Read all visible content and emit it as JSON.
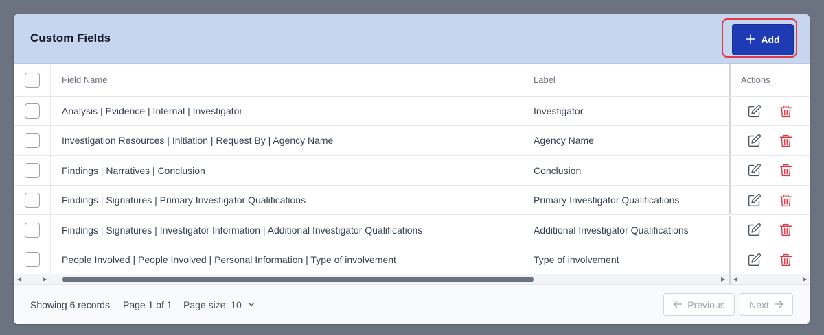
{
  "header": {
    "title": "Custom Fields",
    "add_label": "Add"
  },
  "columns": {
    "field_name": "Field Name",
    "label": "Label",
    "actions": "Actions"
  },
  "rows": [
    {
      "field_name": "Analysis | Evidence | Internal | Investigator",
      "label": "Investigator"
    },
    {
      "field_name": "Investigation Resources | Initiation | Request By | Agency Name",
      "label": "Agency Name"
    },
    {
      "field_name": "Findings | Narratives | Conclusion",
      "label": "Conclusion"
    },
    {
      "field_name": "Findings | Signatures | Primary Investigator Qualifications",
      "label": "Primary Investigator Qualifications"
    },
    {
      "field_name": "Findings | Signatures | Investigator Information | Additional Investigator Qualifications",
      "label": "Additional Investigator Qualifications"
    },
    {
      "field_name": "People Involved | People Involved | Personal Information | Type of involvement",
      "label": "Type of involvement"
    }
  ],
  "footer": {
    "records": "Showing 6 records",
    "page": "Page 1 of 1",
    "page_size": "Page size: 10",
    "previous": "Previous",
    "next": "Next"
  },
  "icons": {
    "add": "plus-icon",
    "edit": "pencil-square-icon",
    "delete": "trash-icon",
    "page_size_toggle": "chevron-down-icon",
    "previous": "arrow-left-icon",
    "next": "arrow-right-icon"
  },
  "colors": {
    "header_bg": "#c6d6ef",
    "add_button": "#1e3bb3",
    "highlight": "#e0394a",
    "delete_icon": "#dc3545"
  }
}
